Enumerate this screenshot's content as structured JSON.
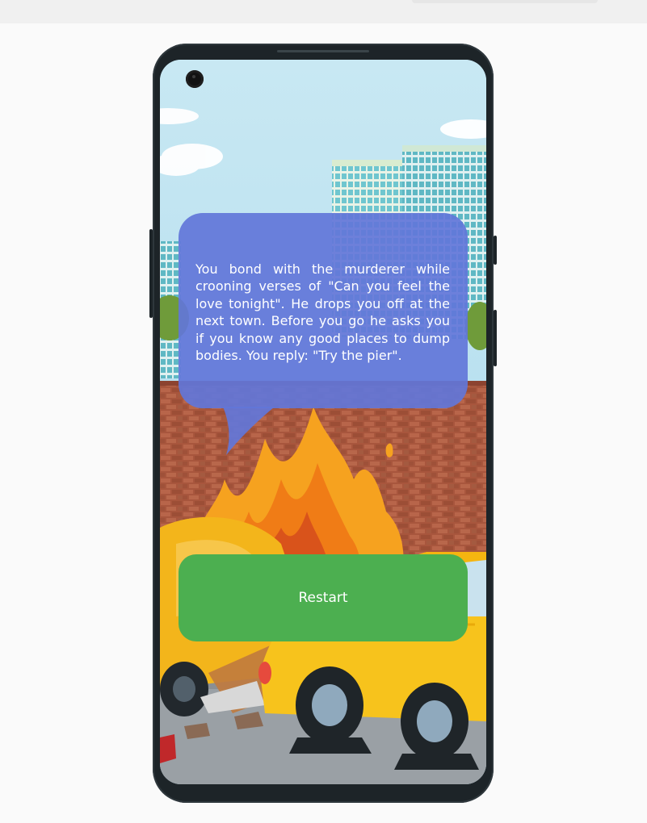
{
  "story": {
    "text": "You bond with the murderer while crooning verses of \"Can you feel the love tonight\". He drops you off at the next town. Before you go he asks you if you know any good places to dump bodies. You reply: \"Try the pier\"."
  },
  "actions": {
    "restart_label": "Restart"
  },
  "scene": {
    "icons": [
      "city-building-icon",
      "fire-icon",
      "taxi-car-icon",
      "wrecked-car-icon",
      "rock-icon"
    ]
  },
  "colors": {
    "bubble": "#6276d9",
    "button": "#4caf50",
    "phone_frame": "#1d2428"
  }
}
